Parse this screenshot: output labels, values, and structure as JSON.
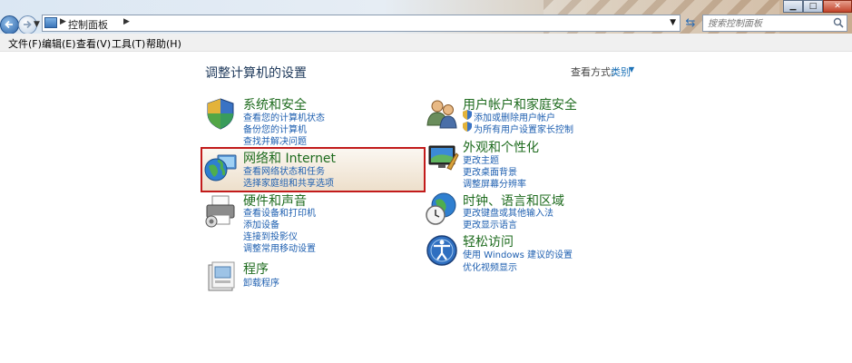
{
  "address": {
    "crumb": "控制面板"
  },
  "search": {
    "placeholder": "搜索控制面板"
  },
  "menu": [
    "文件(F)",
    "编辑(E)",
    "查看(V)",
    "工具(T)",
    "帮助(H)"
  ],
  "page_title": "调整计算机的设置",
  "view_by": {
    "label": "查看方式:",
    "value": "类别"
  },
  "categories": [
    {
      "title": "系统和安全",
      "links": [
        "查看您的计算机状态",
        "备份您的计算机",
        "查找并解决问题"
      ]
    },
    {
      "title": "网络和 Internet",
      "links": [
        "查看网络状态和任务",
        "选择家庭组和共享选项"
      ]
    },
    {
      "title": "硬件和声音",
      "links": [
        "查看设备和打印机",
        "添加设备",
        "连接到投影仪",
        "调整常用移动设置"
      ]
    },
    {
      "title": "程序",
      "links": [
        "卸载程序"
      ]
    },
    {
      "title": "用户帐户和家庭安全",
      "links": [
        "添加或删除用户帐户",
        "为所有用户设置家长控制"
      ]
    },
    {
      "title": "外观和个性化",
      "links": [
        "更改主题",
        "更改桌面背景",
        "调整屏幕分辨率"
      ]
    },
    {
      "title": "时钟、语言和区域",
      "links": [
        "更改键盘或其他输入法",
        "更改显示语言"
      ]
    },
    {
      "title": "轻松访问",
      "links": [
        "使用 Windows 建议的设置",
        "优化视频显示"
      ]
    }
  ],
  "colors": {
    "link": "#1e5fb0",
    "category_title": "#1e6b1e",
    "highlight_border": "#c21b1b"
  },
  "icons": [
    "back-arrow-icon",
    "forward-arrow-icon",
    "control-panel-icon",
    "refresh-icon",
    "search-icon",
    "security-shield-icon",
    "network-globe-icon",
    "printer-icon",
    "programs-icon",
    "users-icon",
    "display-icon",
    "clock-globe-icon",
    "ease-of-access-icon"
  ]
}
